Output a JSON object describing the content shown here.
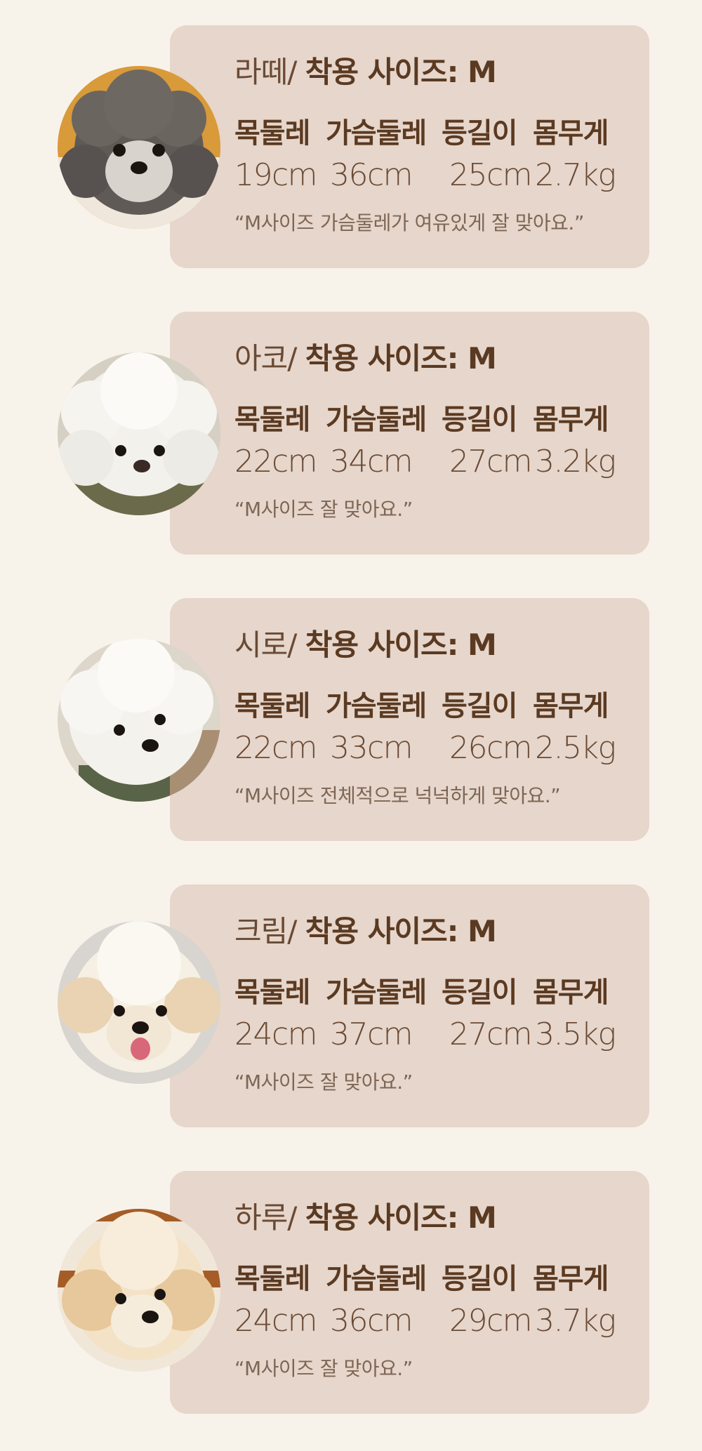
{
  "reviews": [
    {
      "name": "라떼/",
      "size_label": "착용 사이즈: M",
      "headers": [
        "목둘레",
        "가슴둘레",
        "등길이",
        "몸무게"
      ],
      "values": [
        "19cm",
        "36cm",
        "25cm",
        "2.7kg"
      ],
      "comment": "“M사이즈 가슴둘레가 여유있게 잘 맞아요.”",
      "avatar_icon": "gray-poodle-photo"
    },
    {
      "name": "아코/",
      "size_label": "착용 사이즈: M",
      "headers": [
        "목둘레",
        "가슴둘레",
        "등길이",
        "몸무게"
      ],
      "values": [
        "22cm",
        "34cm",
        "27cm",
        "3.2kg"
      ],
      "comment": "“M사이즈 잘 맞아요.”",
      "avatar_icon": "white-bichon-photo"
    },
    {
      "name": "시로/",
      "size_label": "착용 사이즈: M",
      "headers": [
        "목둘레",
        "가슴둘레",
        "등길이",
        "몸무게"
      ],
      "values": [
        "22cm",
        "33cm",
        "26cm",
        "2.5kg"
      ],
      "comment": "“M사이즈 전체적으로 넉넉하게 맞아요.”",
      "avatar_icon": "white-bichon-photo"
    },
    {
      "name": "크림/",
      "size_label": "착용 사이즈: M",
      "headers": [
        "목둘레",
        "가슴둘레",
        "등길이",
        "몸무게"
      ],
      "values": [
        "24cm",
        "37cm",
        "27cm",
        "3.5kg"
      ],
      "comment": "“M사이즈 잘 맞아요.”",
      "avatar_icon": "cream-dog-photo"
    },
    {
      "name": "하루/",
      "size_label": "착용 사이즈: M",
      "headers": [
        "목둘레",
        "가슴둘레",
        "등길이",
        "몸무게"
      ],
      "values": [
        "24cm",
        "36cm",
        "29cm",
        "3.7kg"
      ],
      "comment": "“M사이즈 잘 맞아요.”",
      "avatar_icon": "apricot-dog-photo"
    }
  ],
  "colors": {
    "background": "#f8f3ea",
    "card": "#e6d6cb",
    "text_dark": "#5b3a22",
    "text_muted": "#7e6655"
  }
}
